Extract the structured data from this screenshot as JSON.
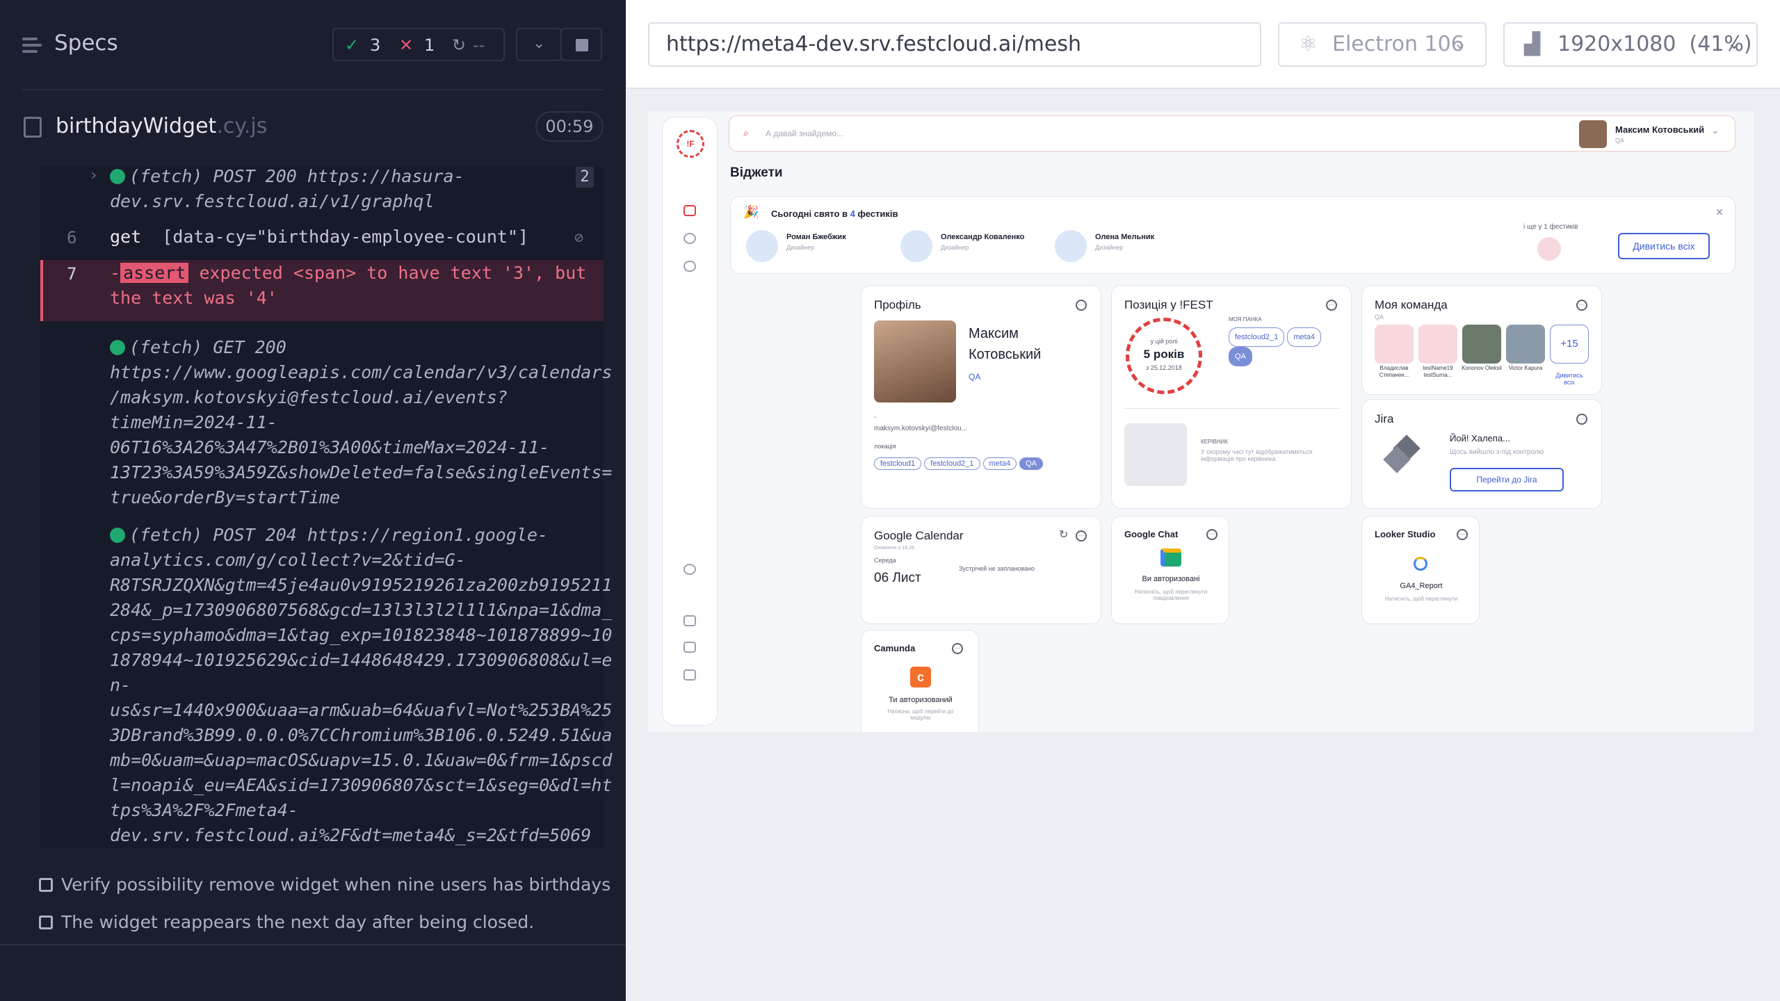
{
  "runner": {
    "title": "Specs",
    "passed": "3",
    "failed": "1",
    "pending": "--",
    "file_name": "birthdayWidget",
    "file_ext": ".cy.js",
    "duration": "00:59",
    "badge_count": "2",
    "log": [
      {
        "text": "(fetch)  POST 200 https://hasura-",
        "cont": "dev.srv.festcloud.ai/v1/graphql"
      },
      {
        "num": "6",
        "cmd": "get",
        "arg": "[data-cy=\"birthday-employee-count\"]"
      },
      {
        "num": "7",
        "assert_label": "assert",
        "msg1": "expected <span> to have text '3', but",
        "msg2": "the text was '4'"
      },
      {
        "lines": [
          "(fetch)  GET 200",
          "https://www.googleapis.com/calendar/v3/calendars",
          "/maksym.kotovskyi@festcloud.ai/events?",
          "timeMin=2024-11-",
          "06T16%3A26%3A47%2B01%3A00&timeMax=2024-11-",
          "13T23%3A59%3A59Z&showDeleted=false&singleEvents=",
          "true&orderBy=startTime"
        ]
      },
      {
        "lines": [
          "(fetch)  POST 204 https://region1.google-",
          "analytics.com/g/collect?v=2&tid=G-",
          "R8TSRJZQXN&gtm=45je4au0v9195219261za200zb9195211",
          "284&_p=1730906807568&gcd=13l3l3l2l1l1&npa=1&dma_",
          "cps=syphamo&dma=1&tag_exp=101823848~101878899~10",
          "1878944~101925629&cid=1448648429.1730906808&ul=e",
          "n-",
          "us&sr=1440x900&uaa=arm&uab=64&uafvl=Not%253BA%25",
          "3DBrand%3B99.0.0.0%7CChromium%3B106.0.5249.51&ua",
          "mb=0&uam=&uap=macOS&uapv=15.0.1&uaw=0&frm=1&pscd",
          "l=noapi&_eu=AEA&sid=1730906807&sct=1&seg=0&dl=ht",
          "tps%3A%2F%2Fmeta4-",
          "dev.srv.festcloud.ai%2F&dt=meta4&_s=2&tfd=5069"
        ]
      }
    ],
    "tests": [
      "Verify possibility remove widget when nine users has birthdays",
      "The widget reappears the next day after being closed."
    ]
  },
  "browser": {
    "url": "https://meta4-dev.srv.festcloud.ai/mesh",
    "engine": "Electron 106",
    "viewport": "1920x1080",
    "zoom": "(41%)"
  },
  "app": {
    "search_placeholder": "А давай знайдемо...",
    "user_name": "Максим Котовський",
    "user_role": "QA",
    "page_title": "Віджети",
    "birthday": {
      "title_pre": "Сьогодні свято в",
      "count": "4",
      "title_post": "фестиків",
      "people": [
        {
          "name": "Роман Бжебжик",
          "role": "Дизайнер"
        },
        {
          "name": "Олександр Коваленко",
          "role": "Дизайнер"
        },
        {
          "name": "Олена Мельник",
          "role": "Дизайнер"
        }
      ],
      "more": "і ще у 1 фестиків",
      "view_all": "Дивитись всіх"
    },
    "profile": {
      "title": "Профіль",
      "first": "Максим",
      "last": "Котовський",
      "role": "QA",
      "dash": "-",
      "email": "maksym.kotovskyi@festclou...",
      "loc_label": "локація",
      "tags": [
        "festcloud1",
        "festcloud2_1",
        "meta4",
        "QA"
      ]
    },
    "position": {
      "title": "Позиція у !FEST",
      "in_role": "у цій ролі",
      "years": "5 років",
      "since": "з 25.12.2018",
      "team_label": "МОЯ ПАНКА",
      "tags": [
        "festcloud2_1",
        "meta4",
        "QA"
      ],
      "lead_label": "КЕРІВНИК",
      "lead_text": "У скорому часі тут відображатиметься інформація про керівника"
    },
    "team": {
      "title": "Моя команда",
      "role": "QA",
      "members": [
        {
          "name": "Владислав Степанен..."
        },
        {
          "name": "testName19 testSurna..."
        },
        {
          "name": "Kononov Oleksii"
        },
        {
          "name": "Victor Kapura"
        }
      ],
      "more": "+15",
      "view_all": "Дивитись всіх"
    },
    "jira": {
      "title": "Jira",
      "msg": "Йой! Халепа...",
      "sub": "Щось вийшло з-під контролю",
      "button": "Перейти до Jira"
    },
    "calendar": {
      "title": "Google Calendar",
      "updated": "Оновлено о 16:26",
      "weekday": "Середа",
      "date": "06 Лист",
      "none": "Зустрічей не заплановано"
    },
    "chat": {
      "title": "Google Chat",
      "status": "Ви авторизовані",
      "sub": "Натисніть, щоб переглянути повідомлення"
    },
    "looker": {
      "title": "Looker Studio",
      "report": "GA4_Report",
      "sub": "Натисніть, щоб переглянути"
    },
    "camunda": {
      "title": "Camunda",
      "status": "Ти авторизований",
      "sub": "Натисни, щоб перейти до модулю"
    }
  }
}
